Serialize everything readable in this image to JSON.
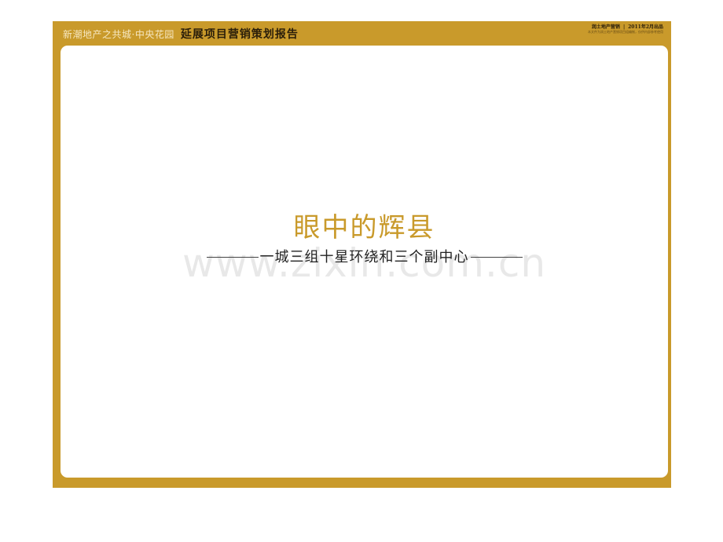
{
  "header": {
    "project_subtitle": "新潮地产之共城·中央花园",
    "report_title": "延展项目营销策划报告",
    "company": "润土地产营销",
    "separator": "|",
    "date": "2011年2月出品",
    "tagline": "本文件为润土地产营销项目组编制，仅供内部参考使用"
  },
  "slide": {
    "title": "眼中的辉县",
    "subtitle": "一城三组十星环绕和三个副中心"
  },
  "watermark": {
    "text": "www.zixin.com.cn"
  },
  "colors": {
    "frame": "#c99a2b",
    "title": "#c99a2b",
    "panel": "#ffffff"
  }
}
